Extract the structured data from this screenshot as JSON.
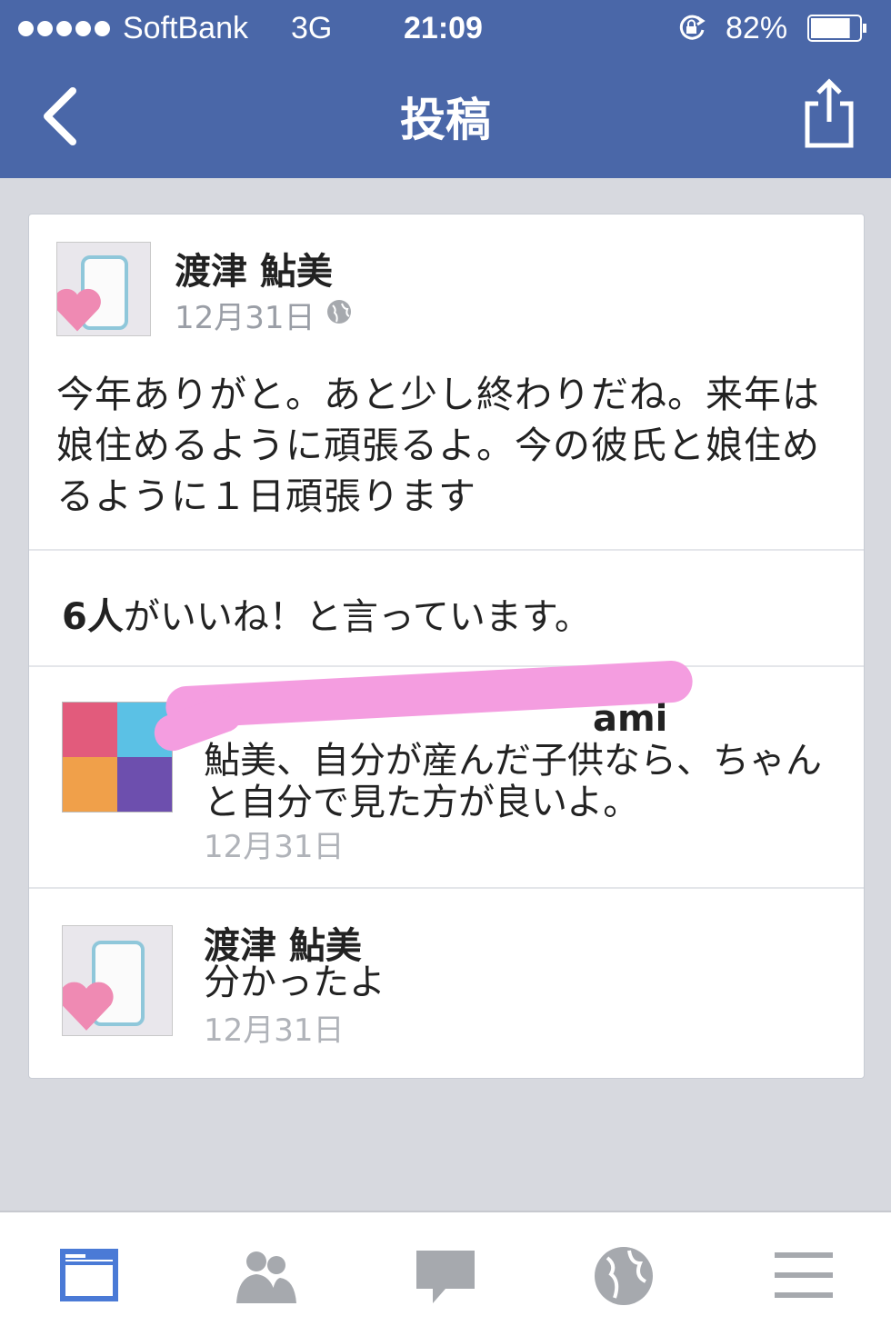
{
  "status_bar": {
    "carrier": "SoftBank",
    "network": "3G",
    "time": "21:09",
    "battery_percent": "82%",
    "battery_level": 0.82,
    "orientation_lock_icon": "orientation-lock-icon"
  },
  "nav": {
    "title": "投稿",
    "back_icon": "chevron-left-icon",
    "share_icon": "share-icon"
  },
  "post": {
    "author": "渡津 鮎美",
    "date": "12月31日",
    "privacy_icon": "globe-icon",
    "text": "今年ありがと。あと少し終わりだね。来年は娘住めるように頑張るよ。今の彼氏と娘住めるように１日頑張ります",
    "likes_count": "6人",
    "likes_suffix": "がいいね！と言っています。"
  },
  "comments": [
    {
      "name_visible_fragment": "ami",
      "text": "鮎美、自分が産んだ子供なら、ちゃんと自分で見た方が良いよ。",
      "date": "12月31日"
    },
    {
      "name": "渡津 鮎美",
      "text": "分かったよ",
      "date": "12月31日"
    }
  ],
  "tabs": [
    {
      "icon": "news-feed-icon",
      "active": true
    },
    {
      "icon": "friends-icon",
      "active": false
    },
    {
      "icon": "messages-icon",
      "active": false
    },
    {
      "icon": "notifications-globe-icon",
      "active": false
    },
    {
      "icon": "menu-icon",
      "active": false
    }
  ],
  "colors": {
    "nav_blue": "#4a67a8",
    "active_tab": "#4a7ad6",
    "inactive_tab": "#a6a9ae",
    "redaction_pink": "#f49de0"
  }
}
